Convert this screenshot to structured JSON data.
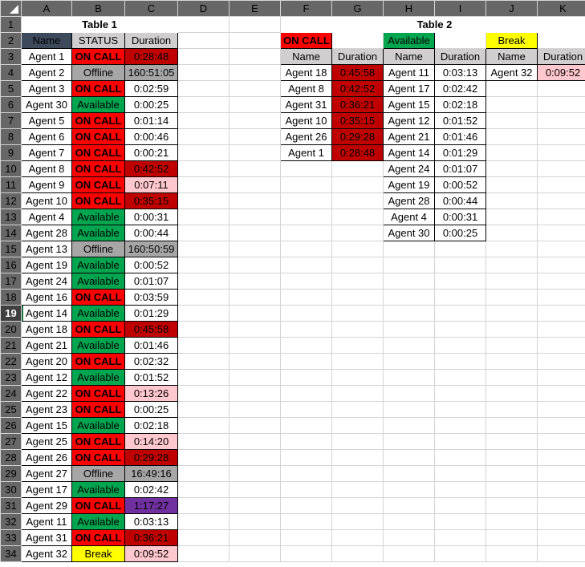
{
  "spreadsheet": {
    "column_headers": [
      "A",
      "B",
      "C",
      "D",
      "E",
      "F",
      "G",
      "H",
      "I",
      "J",
      "K"
    ],
    "row_headers": [
      "1",
      "2",
      "3",
      "4",
      "5",
      "6",
      "7",
      "8",
      "9",
      "10",
      "11",
      "12",
      "13",
      "14",
      "15",
      "16",
      "17",
      "18",
      "19",
      "20",
      "21",
      "22",
      "23",
      "24",
      "25",
      "26",
      "27",
      "28",
      "29",
      "30",
      "31",
      "32",
      "33",
      "34"
    ],
    "selected_row": "19",
    "corner_name": "select-all-corner"
  },
  "table1": {
    "title": "Table 1",
    "headers": {
      "name": "Name",
      "status": "STATUS",
      "duration": "Duration"
    },
    "rows": [
      {
        "row": "3",
        "name": "Agent 1",
        "status": "ON CALL",
        "duration": "0:28:48",
        "status_style": "st-oncall",
        "duration_style": "d-dark"
      },
      {
        "row": "4",
        "name": "Agent 2",
        "status": "Offline",
        "duration": "160:51:05",
        "status_style": "st-offline",
        "duration_style": "d-gray"
      },
      {
        "row": "5",
        "name": "Agent 3",
        "status": "ON CALL",
        "duration": "0:02:59",
        "status_style": "st-oncall",
        "duration_style": "d-plain"
      },
      {
        "row": "6",
        "name": "Agent 30",
        "status": "Available",
        "duration": "0:00:25",
        "status_style": "st-avail",
        "duration_style": "d-plain"
      },
      {
        "row": "7",
        "name": "Agent 5",
        "status": "ON CALL",
        "duration": "0:01:14",
        "status_style": "st-oncall",
        "duration_style": "d-plain"
      },
      {
        "row": "8",
        "name": "Agent 6",
        "status": "ON CALL",
        "duration": "0:00:46",
        "status_style": "st-oncall",
        "duration_style": "d-plain"
      },
      {
        "row": "9",
        "name": "Agent 7",
        "status": "ON CALL",
        "duration": "0:00:21",
        "status_style": "st-oncall",
        "duration_style": "d-plain"
      },
      {
        "row": "10",
        "name": "Agent 8",
        "status": "ON CALL",
        "duration": "0:42:52",
        "status_style": "st-oncall",
        "duration_style": "d-dark"
      },
      {
        "row": "11",
        "name": "Agent 9",
        "status": "ON CALL",
        "duration": "0:07:11",
        "status_style": "st-oncall",
        "duration_style": "d-pink"
      },
      {
        "row": "12",
        "name": "Agent 10",
        "status": "ON CALL",
        "duration": "0:35:15",
        "status_style": "st-oncall",
        "duration_style": "d-dark"
      },
      {
        "row": "13",
        "name": "Agent 4",
        "status": "Available",
        "duration": "0:00:31",
        "status_style": "st-avail",
        "duration_style": "d-plain"
      },
      {
        "row": "14",
        "name": "Agent 28",
        "status": "Available",
        "duration": "0:00:44",
        "status_style": "st-avail",
        "duration_style": "d-plain"
      },
      {
        "row": "15",
        "name": "Agent 13",
        "status": "Offline",
        "duration": "160:50:59",
        "status_style": "st-offline",
        "duration_style": "d-gray"
      },
      {
        "row": "16",
        "name": "Agent 19",
        "status": "Available",
        "duration": "0:00:52",
        "status_style": "st-avail",
        "duration_style": "d-plain"
      },
      {
        "row": "17",
        "name": "Agent 24",
        "status": "Available",
        "duration": "0:01:07",
        "status_style": "st-avail",
        "duration_style": "d-plain"
      },
      {
        "row": "18",
        "name": "Agent 16",
        "status": "ON CALL",
        "duration": "0:03:59",
        "status_style": "st-oncall",
        "duration_style": "d-plain"
      },
      {
        "row": "19",
        "name": "Agent 14",
        "status": "Available",
        "duration": "0:01:29",
        "status_style": "st-avail",
        "duration_style": "d-plain"
      },
      {
        "row": "20",
        "name": "Agent 18",
        "status": "ON CALL",
        "duration": "0:45:58",
        "status_style": "st-oncall",
        "duration_style": "d-dark"
      },
      {
        "row": "21",
        "name": "Agent 21",
        "status": "Available",
        "duration": "0:01:46",
        "status_style": "st-avail",
        "duration_style": "d-plain"
      },
      {
        "row": "22",
        "name": "Agent 20",
        "status": "ON CALL",
        "duration": "0:02:32",
        "status_style": "st-oncall",
        "duration_style": "d-plain"
      },
      {
        "row": "23",
        "name": "Agent 12",
        "status": "Available",
        "duration": "0:01:52",
        "status_style": "st-avail",
        "duration_style": "d-plain"
      },
      {
        "row": "24",
        "name": "Agent 22",
        "status": "ON CALL",
        "duration": "0:13:26",
        "status_style": "st-oncall",
        "duration_style": "d-pink"
      },
      {
        "row": "25",
        "name": "Agent 23",
        "status": "ON CALL",
        "duration": "0:00:25",
        "status_style": "st-oncall",
        "duration_style": "d-plain"
      },
      {
        "row": "26",
        "name": "Agent 15",
        "status": "Available",
        "duration": "0:02:18",
        "status_style": "st-avail",
        "duration_style": "d-plain"
      },
      {
        "row": "27",
        "name": "Agent 25",
        "status": "ON CALL",
        "duration": "0:14:20",
        "status_style": "st-oncall",
        "duration_style": "d-pink"
      },
      {
        "row": "28",
        "name": "Agent 26",
        "status": "ON CALL",
        "duration": "0:29:28",
        "status_style": "st-oncall",
        "duration_style": "d-dark"
      },
      {
        "row": "29",
        "name": "Agent 27",
        "status": "Offline",
        "duration": "16:49:16",
        "status_style": "st-offline",
        "duration_style": "d-gray"
      },
      {
        "row": "30",
        "name": "Agent 17",
        "status": "Available",
        "duration": "0:02:42",
        "status_style": "st-avail",
        "duration_style": "d-plain"
      },
      {
        "row": "31",
        "name": "Agent 29",
        "status": "ON CALL",
        "duration": "1:17:27",
        "status_style": "st-oncall",
        "duration_style": "d-purple"
      },
      {
        "row": "32",
        "name": "Agent 11",
        "status": "Available",
        "duration": "0:03:13",
        "status_style": "st-avail",
        "duration_style": "d-plain"
      },
      {
        "row": "33",
        "name": "Agent 31",
        "status": "ON CALL",
        "duration": "0:36:21",
        "status_style": "st-oncall",
        "duration_style": "d-dark"
      },
      {
        "row": "34",
        "name": "Agent 32",
        "status": "Break",
        "duration": "0:09:52",
        "status_style": "st-break",
        "duration_style": "d-pink"
      }
    ]
  },
  "table2": {
    "title": "Table 2",
    "group_headers": {
      "oncall": "ON CALL",
      "available": "Available",
      "break": "Break"
    },
    "column_headers": {
      "name": "Name",
      "duration": "Duration"
    },
    "oncall_rows": [
      {
        "name": "Agent 18",
        "duration": "0:45:58",
        "duration_style": "d-dark"
      },
      {
        "name": "Agent 8",
        "duration": "0:42:52",
        "duration_style": "d-dark"
      },
      {
        "name": "Agent 31",
        "duration": "0:36:21",
        "duration_style": "d-dark"
      },
      {
        "name": "Agent 10",
        "duration": "0:35:15",
        "duration_style": "d-dark"
      },
      {
        "name": "Agent 26",
        "duration": "0:29:28",
        "duration_style": "d-dark"
      },
      {
        "name": "Agent 1",
        "duration": "0:28:48",
        "duration_style": "d-dark"
      }
    ],
    "available_rows": [
      {
        "name": "Agent 11",
        "duration": "0:03:13",
        "duration_style": "d-plain"
      },
      {
        "name": "Agent 17",
        "duration": "0:02:42",
        "duration_style": "d-plain"
      },
      {
        "name": "Agent 15",
        "duration": "0:02:18",
        "duration_style": "d-plain"
      },
      {
        "name": "Agent 12",
        "duration": "0:01:52",
        "duration_style": "d-plain"
      },
      {
        "name": "Agent 21",
        "duration": "0:01:46",
        "duration_style": "d-plain"
      },
      {
        "name": "Agent 14",
        "duration": "0:01:29",
        "duration_style": "d-plain"
      },
      {
        "name": "Agent 24",
        "duration": "0:01:07",
        "duration_style": "d-plain"
      },
      {
        "name": "Agent 19",
        "duration": "0:00:52",
        "duration_style": "d-plain"
      },
      {
        "name": "Agent 28",
        "duration": "0:00:44",
        "duration_style": "d-plain"
      },
      {
        "name": "Agent 4",
        "duration": "0:00:31",
        "duration_style": "d-plain"
      },
      {
        "name": "Agent 30",
        "duration": "0:00:25",
        "duration_style": "d-plain"
      }
    ],
    "break_rows": [
      {
        "name": "Agent 32",
        "duration": "0:09:52",
        "duration_style": "d-pink"
      }
    ]
  },
  "colors": {
    "on_call": "#ff0000",
    "available": "#00a550",
    "offline": "#a6a6a6",
    "break": "#ffff00",
    "duration_high": "#c00000",
    "duration_mid": "#ffc7ce",
    "duration_purple": "#7030a0",
    "header_name": "#3d4a5c",
    "header_gray": "#d0cece"
  }
}
